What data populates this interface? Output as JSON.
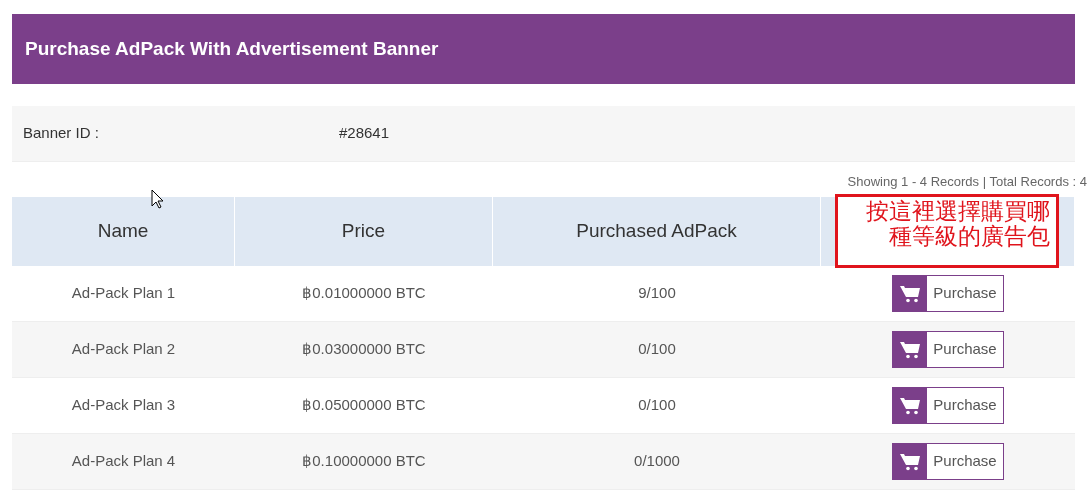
{
  "title": "Purchase AdPack With Advertisement Banner",
  "banner": {
    "label": "Banner ID :",
    "value": "#28641"
  },
  "records_info": "Showing 1 - 4 Records | Total Records : 4",
  "table": {
    "columns": [
      "Name",
      "Price",
      "Purchased AdPack"
    ],
    "rows": [
      {
        "name": "Ad-Pack Plan 1",
        "price": "฿0.01000000 BTC",
        "purchased": "9/100",
        "action": "Purchase"
      },
      {
        "name": "Ad-Pack Plan 2",
        "price": "฿0.03000000 BTC",
        "purchased": "0/100",
        "action": "Purchase"
      },
      {
        "name": "Ad-Pack Plan 3",
        "price": "฿0.05000000 BTC",
        "purchased": "0/100",
        "action": "Purchase"
      },
      {
        "name": "Ad-Pack Plan 4",
        "price": "฿0.10000000 BTC",
        "purchased": "0/1000",
        "action": "Purchase"
      }
    ]
  },
  "annotation": {
    "lines": [
      "按這裡選擇購買哪",
      "種等級的廣告包"
    ]
  }
}
